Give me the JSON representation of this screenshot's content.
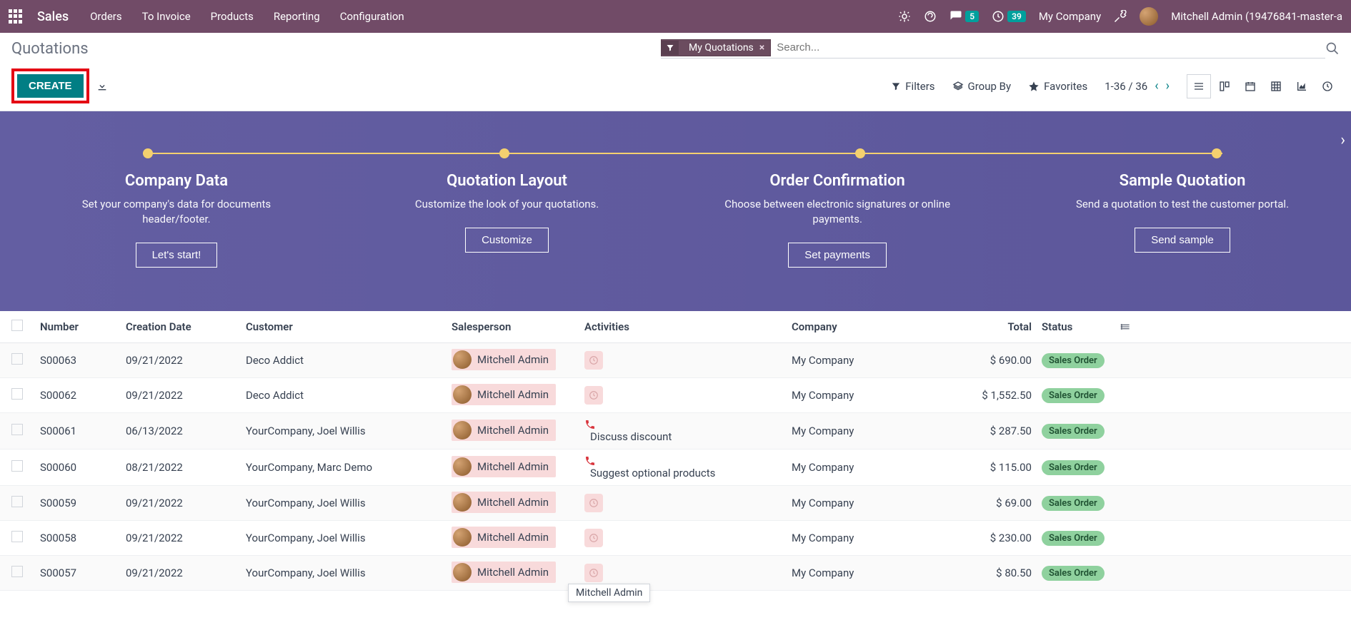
{
  "nav": {
    "brand": "Sales",
    "menu": [
      "Orders",
      "To Invoice",
      "Products",
      "Reporting",
      "Configuration"
    ],
    "msg_count": "5",
    "sched_count": "39",
    "company": "My Company",
    "user": "Mitchell Admin (19476841-master-a"
  },
  "cp": {
    "breadcrumb": "Quotations",
    "filter_chip": "My Quotations",
    "search_placeholder": "Search...",
    "create_label": "CREATE",
    "filters_label": "Filters",
    "group_label": "Group By",
    "fav_label": "Favorites",
    "pager": "1-36 / 36"
  },
  "onboard": {
    "steps": [
      {
        "title": "Company Data",
        "desc": "Set your company's data for documents header/footer.",
        "btn": "Let's start!"
      },
      {
        "title": "Quotation Layout",
        "desc": "Customize the look of your quotations.",
        "btn": "Customize"
      },
      {
        "title": "Order Confirmation",
        "desc": "Choose between electronic signatures or online payments.",
        "btn": "Set payments"
      },
      {
        "title": "Sample Quotation",
        "desc": "Send a quotation to test the customer portal.",
        "btn": "Send sample"
      }
    ]
  },
  "table": {
    "headers": {
      "number": "Number",
      "date": "Creation Date",
      "cust": "Customer",
      "sales": "Salesperson",
      "act": "Activities",
      "comp": "Company",
      "total": "Total",
      "status": "Status"
    },
    "rows": [
      {
        "num": "S00063",
        "date": "09/21/2022",
        "cust": "Deco Addict",
        "sales": "Mitchell Admin",
        "act": "",
        "comp": "My Company",
        "total": "$ 690.00",
        "status": "Sales Order"
      },
      {
        "num": "S00062",
        "date": "09/21/2022",
        "cust": "Deco Addict",
        "sales": "Mitchell Admin",
        "act": "",
        "comp": "My Company",
        "total": "$ 1,552.50",
        "status": "Sales Order"
      },
      {
        "num": "S00061",
        "date": "06/13/2022",
        "cust": "YourCompany, Joel Willis",
        "sales": "Mitchell Admin",
        "act": "Discuss discount",
        "comp": "My Company",
        "total": "$ 287.50",
        "status": "Sales Order"
      },
      {
        "num": "S00060",
        "date": "08/21/2022",
        "cust": "YourCompany, Marc Demo",
        "sales": "Mitchell Admin",
        "act": "Suggest optional products",
        "comp": "My Company",
        "total": "$ 115.00",
        "status": "Sales Order"
      },
      {
        "num": "S00059",
        "date": "09/21/2022",
        "cust": "YourCompany, Joel Willis",
        "sales": "Mitchell Admin",
        "act": "",
        "comp": "My Company",
        "total": "$ 69.00",
        "status": "Sales Order"
      },
      {
        "num": "S00058",
        "date": "09/21/2022",
        "cust": "YourCompany, Joel Willis",
        "sales": "Mitchell Admin",
        "act": "",
        "comp": "My Company",
        "total": "$ 230.00",
        "status": "Sales Order"
      },
      {
        "num": "S00057",
        "date": "09/21/2022",
        "cust": "YourCompany, Joel Willis",
        "sales": "Mitchell Admin",
        "act": "",
        "comp": "My Company",
        "total": "$ 80.50",
        "status": "Sales Order"
      }
    ],
    "tooltip": "Mitchell Admin"
  }
}
